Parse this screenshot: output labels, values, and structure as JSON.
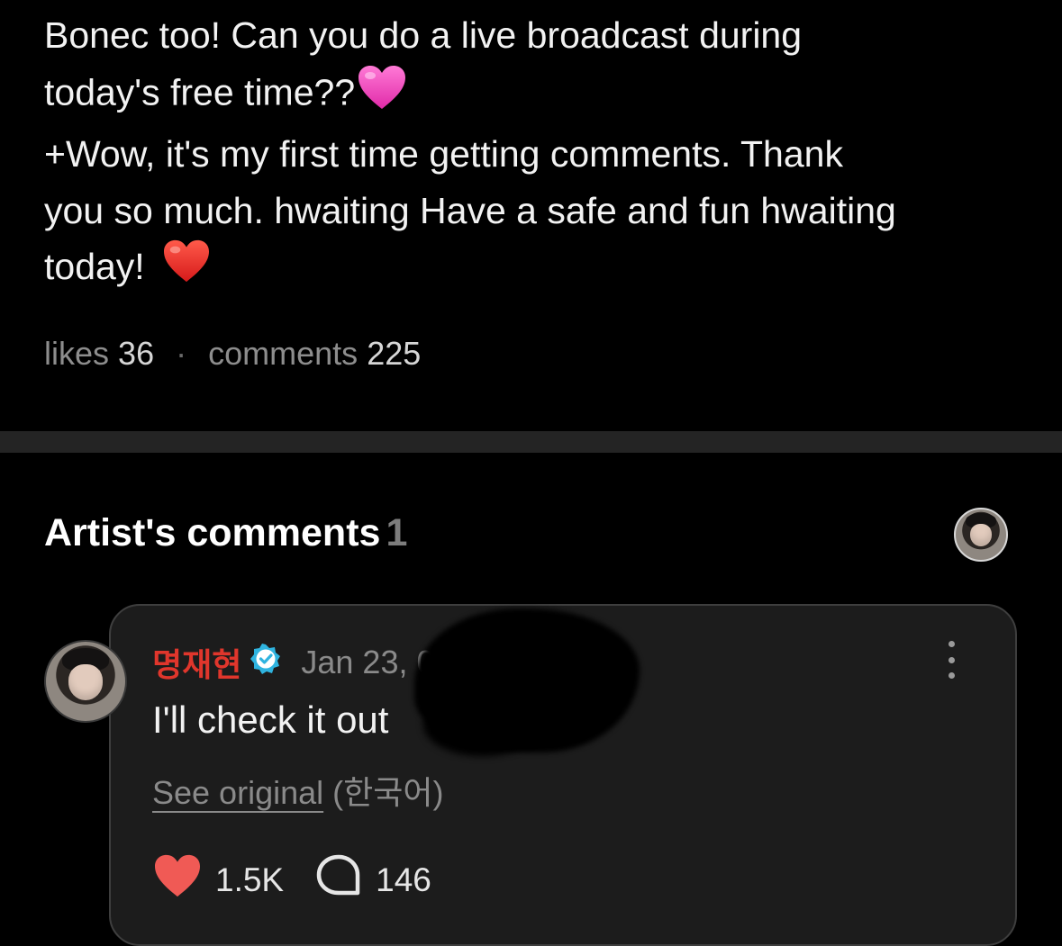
{
  "post": {
    "lines": [
      "Bonec too! Can you do a live broadcast during",
      "today's free time??",
      "+Wow, it's my first time getting comments. Thank",
      "you so much. hwaiting Have a safe and fun hwaiting",
      "today!"
    ],
    "emoji_after_line_2": "pink-heart",
    "emoji_after_line_5": "red-heart",
    "stats": {
      "likes_label": "likes",
      "likes_count": "36",
      "separator": "·",
      "comments_label": "comments",
      "comments_count": "225"
    }
  },
  "artist_comments": {
    "title": "Artist's comments",
    "count": "1",
    "comment": {
      "author": "명재현",
      "verified": true,
      "date": "Jan 23, 0",
      "text": "I'll check it out",
      "see_original_label": "See original",
      "original_language": "(한국어)",
      "like_count": "1.5K",
      "reply_count": "146"
    }
  },
  "colors": {
    "background": "#000000",
    "card": "#1c1c1c",
    "author_name": "#e0362c",
    "verified_badge": "#2fb4e0",
    "like_heart": "#f05a55"
  }
}
